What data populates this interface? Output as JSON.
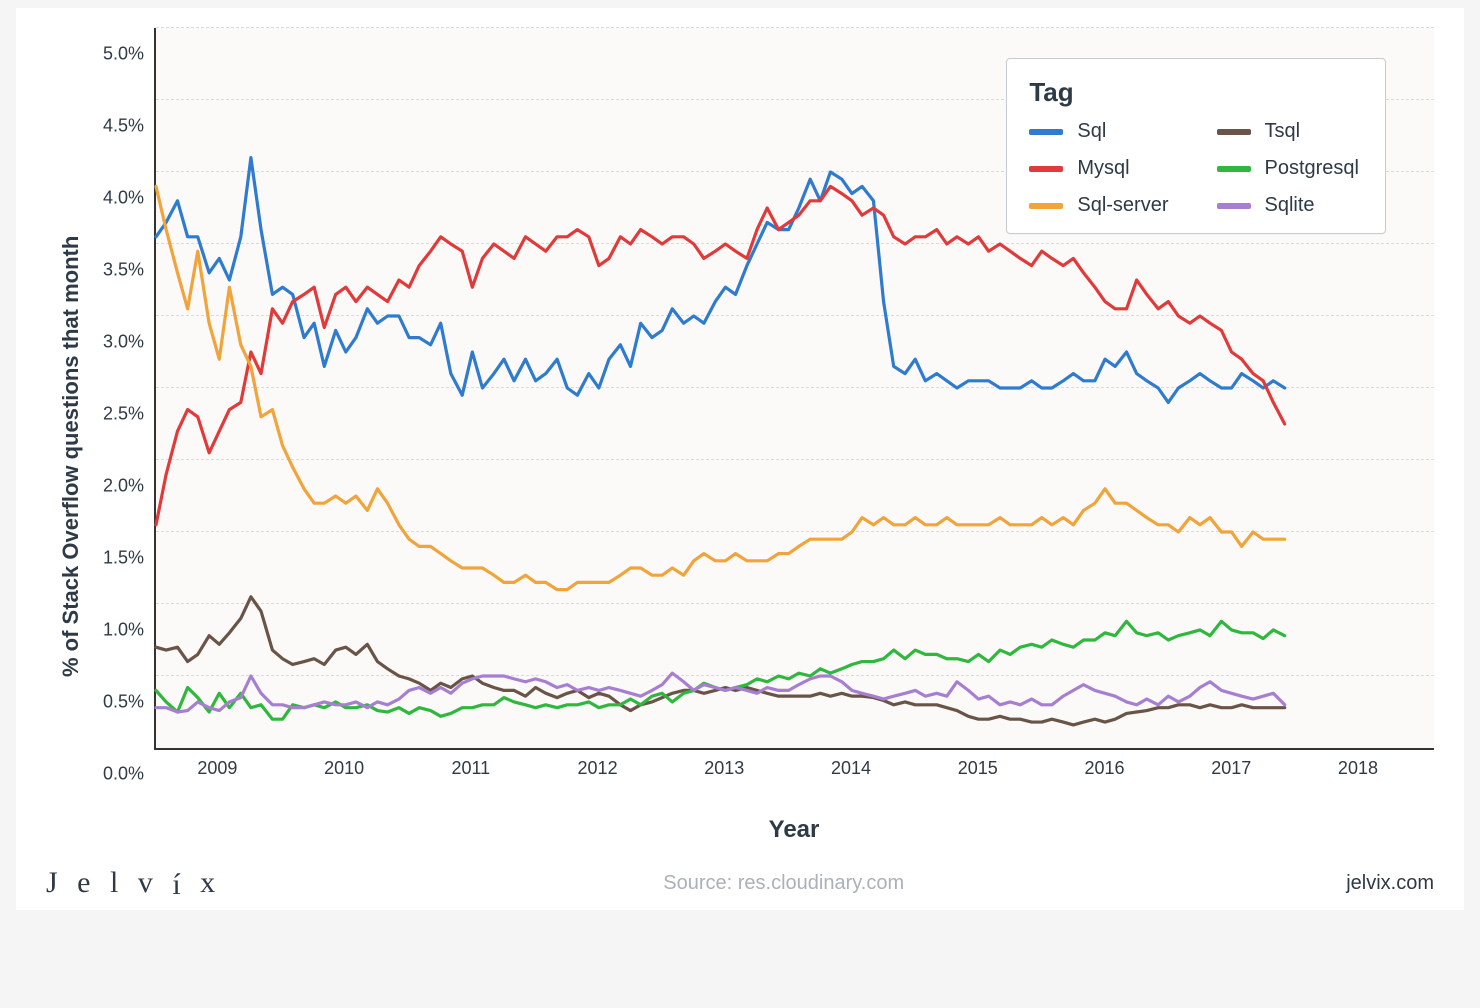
{
  "chart_data": {
    "type": "line",
    "title": null,
    "xlabel": "Year",
    "ylabel": "% of Stack Overflow questions that month",
    "x_numeric_range": [
      2008.5,
      2018.6
    ],
    "x_ticks": [
      2009,
      2010,
      2011,
      2012,
      2013,
      2014,
      2015,
      2016,
      2017,
      2018
    ],
    "y_ticks": [
      0.0,
      0.5,
      1.0,
      1.5,
      2.0,
      2.5,
      3.0,
      3.5,
      4.0,
      4.5,
      5.0
    ],
    "y_tick_labels": [
      "0.0%",
      "0.5%",
      "1.0%",
      "1.5%",
      "2.0%",
      "2.5%",
      "3.0%",
      "3.5%",
      "4.0%",
      "4.5%",
      "5.0%"
    ],
    "ylim": [
      0.0,
      5.0
    ],
    "legend": {
      "title": "Tag",
      "position": "top-right"
    },
    "grid": {
      "x": false,
      "y": true,
      "style": "dashed"
    },
    "x": [
      2008.5,
      2008.58,
      2008.67,
      2008.75,
      2008.83,
      2008.92,
      2009.0,
      2009.08,
      2009.17,
      2009.25,
      2009.33,
      2009.42,
      2009.5,
      2009.58,
      2009.67,
      2009.75,
      2009.83,
      2009.92,
      2010.0,
      2010.08,
      2010.17,
      2010.25,
      2010.33,
      2010.42,
      2010.5,
      2010.58,
      2010.67,
      2010.75,
      2010.83,
      2010.92,
      2011.0,
      2011.08,
      2011.17,
      2011.25,
      2011.33,
      2011.42,
      2011.5,
      2011.58,
      2011.67,
      2011.75,
      2011.83,
      2011.92,
      2012.0,
      2012.08,
      2012.17,
      2012.25,
      2012.33,
      2012.42,
      2012.5,
      2012.58,
      2012.67,
      2012.75,
      2012.83,
      2012.92,
      2013.0,
      2013.08,
      2013.17,
      2013.25,
      2013.33,
      2013.42,
      2013.5,
      2013.58,
      2013.67,
      2013.75,
      2013.83,
      2013.92,
      2014.0,
      2014.08,
      2014.17,
      2014.25,
      2014.33,
      2014.42,
      2014.5,
      2014.58,
      2014.67,
      2014.75,
      2014.83,
      2014.92,
      2015.0,
      2015.08,
      2015.17,
      2015.25,
      2015.33,
      2015.42,
      2015.5,
      2015.58,
      2015.67,
      2015.75,
      2015.83,
      2015.92,
      2016.0,
      2016.08,
      2016.17,
      2016.25,
      2016.33,
      2016.42,
      2016.5,
      2016.58,
      2016.67,
      2016.75,
      2016.83,
      2016.92,
      2017.0,
      2017.08,
      2017.17,
      2017.25,
      2017.33,
      2017.42,
      2017.5,
      2017.58,
      2017.67,
      2017.75,
      2017.83,
      2017.92,
      2018.0,
      2018.08,
      2018.17,
      2018.25,
      2018.33,
      2018.42,
      2018.5,
      2018.58
    ],
    "series": [
      {
        "name": "Sql",
        "color": "#2e7bcf",
        "values": [
          3.55,
          3.65,
          3.8,
          3.55,
          3.55,
          3.3,
          3.4,
          3.25,
          3.55,
          4.1,
          3.6,
          3.15,
          3.2,
          3.15,
          2.85,
          2.95,
          2.65,
          2.9,
          2.75,
          2.85,
          3.05,
          2.95,
          3.0,
          3.0,
          2.85,
          2.85,
          2.8,
          2.95,
          2.6,
          2.45,
          2.75,
          2.5,
          2.6,
          2.7,
          2.55,
          2.7,
          2.55,
          2.6,
          2.7,
          2.5,
          2.45,
          2.6,
          2.5,
          2.7,
          2.8,
          2.65,
          2.95,
          2.85,
          2.9,
          3.05,
          2.95,
          3.0,
          2.95,
          3.1,
          3.2,
          3.15,
          3.35,
          3.5,
          3.65,
          3.6,
          3.6,
          3.75,
          3.95,
          3.8,
          4.0,
          3.95,
          3.85,
          3.9,
          3.8,
          3.1,
          2.65,
          2.6,
          2.7,
          2.55,
          2.6,
          2.55,
          2.5,
          2.55,
          2.55,
          2.55,
          2.5,
          2.5,
          2.5,
          2.55,
          2.5,
          2.5,
          2.55,
          2.6,
          2.55,
          2.55,
          2.7,
          2.65,
          2.75,
          2.6,
          2.55,
          2.5,
          2.4,
          2.5,
          2.55,
          2.6,
          2.55,
          2.5,
          2.5,
          2.6,
          2.55,
          2.5,
          2.55,
          2.5
        ]
      },
      {
        "name": "Mysql",
        "color": "#e13a3a",
        "values": [
          1.55,
          1.9,
          2.2,
          2.35,
          2.3,
          2.05,
          2.2,
          2.35,
          2.4,
          2.75,
          2.6,
          3.05,
          2.95,
          3.1,
          3.15,
          3.2,
          2.92,
          3.15,
          3.2,
          3.1,
          3.2,
          3.15,
          3.1,
          3.25,
          3.2,
          3.35,
          3.45,
          3.55,
          3.5,
          3.45,
          3.2,
          3.4,
          3.5,
          3.45,
          3.4,
          3.55,
          3.5,
          3.45,
          3.55,
          3.55,
          3.6,
          3.55,
          3.35,
          3.4,
          3.55,
          3.5,
          3.6,
          3.55,
          3.5,
          3.55,
          3.55,
          3.5,
          3.4,
          3.45,
          3.5,
          3.45,
          3.4,
          3.6,
          3.75,
          3.6,
          3.65,
          3.7,
          3.8,
          3.8,
          3.9,
          3.85,
          3.8,
          3.7,
          3.75,
          3.7,
          3.55,
          3.5,
          3.55,
          3.55,
          3.6,
          3.5,
          3.55,
          3.5,
          3.55,
          3.45,
          3.5,
          3.45,
          3.4,
          3.35,
          3.45,
          3.4,
          3.35,
          3.4,
          3.3,
          3.2,
          3.1,
          3.05,
          3.05,
          3.25,
          3.15,
          3.05,
          3.1,
          3.0,
          2.95,
          3.0,
          2.95,
          2.9,
          2.75,
          2.7,
          2.6,
          2.55,
          2.4,
          2.25
        ]
      },
      {
        "name": "Sql-server",
        "color": "#f1a33c",
        "values": [
          3.9,
          3.6,
          3.3,
          3.05,
          3.45,
          2.95,
          2.7,
          3.2,
          2.8,
          2.65,
          2.3,
          2.35,
          2.1,
          1.95,
          1.8,
          1.7,
          1.7,
          1.75,
          1.7,
          1.75,
          1.65,
          1.8,
          1.7,
          1.55,
          1.45,
          1.4,
          1.4,
          1.35,
          1.3,
          1.25,
          1.25,
          1.25,
          1.2,
          1.15,
          1.15,
          1.2,
          1.15,
          1.15,
          1.1,
          1.1,
          1.15,
          1.15,
          1.15,
          1.15,
          1.2,
          1.25,
          1.25,
          1.2,
          1.2,
          1.25,
          1.2,
          1.3,
          1.35,
          1.3,
          1.3,
          1.35,
          1.3,
          1.3,
          1.3,
          1.35,
          1.35,
          1.4,
          1.45,
          1.45,
          1.45,
          1.45,
          1.5,
          1.6,
          1.55,
          1.6,
          1.55,
          1.55,
          1.6,
          1.55,
          1.55,
          1.6,
          1.55,
          1.55,
          1.55,
          1.55,
          1.6,
          1.55,
          1.55,
          1.55,
          1.6,
          1.55,
          1.6,
          1.55,
          1.65,
          1.7,
          1.8,
          1.7,
          1.7,
          1.65,
          1.6,
          1.55,
          1.55,
          1.5,
          1.6,
          1.55,
          1.6,
          1.5,
          1.5,
          1.4,
          1.5,
          1.45,
          1.45,
          1.45
        ]
      },
      {
        "name": "Tsql",
        "color": "#6a5447",
        "values": [
          0.7,
          0.68,
          0.7,
          0.6,
          0.65,
          0.78,
          0.72,
          0.8,
          0.9,
          1.05,
          0.95,
          0.68,
          0.62,
          0.58,
          0.6,
          0.62,
          0.58,
          0.68,
          0.7,
          0.65,
          0.72,
          0.6,
          0.55,
          0.5,
          0.48,
          0.45,
          0.4,
          0.45,
          0.42,
          0.48,
          0.5,
          0.45,
          0.42,
          0.4,
          0.4,
          0.36,
          0.42,
          0.38,
          0.35,
          0.38,
          0.4,
          0.35,
          0.38,
          0.36,
          0.3,
          0.26,
          0.3,
          0.32,
          0.35,
          0.38,
          0.4,
          0.4,
          0.38,
          0.4,
          0.42,
          0.4,
          0.42,
          0.4,
          0.38,
          0.36,
          0.36,
          0.36,
          0.36,
          0.38,
          0.36,
          0.38,
          0.36,
          0.36,
          0.35,
          0.33,
          0.3,
          0.32,
          0.3,
          0.3,
          0.3,
          0.28,
          0.26,
          0.22,
          0.2,
          0.2,
          0.22,
          0.2,
          0.2,
          0.18,
          0.18,
          0.2,
          0.18,
          0.16,
          0.18,
          0.2,
          0.18,
          0.2,
          0.24,
          0.25,
          0.26,
          0.28,
          0.28,
          0.3,
          0.3,
          0.28,
          0.3,
          0.28,
          0.28,
          0.3,
          0.28,
          0.28,
          0.28,
          0.28
        ]
      },
      {
        "name": "Postgresql",
        "color": "#2fb83d",
        "values": [
          0.4,
          0.32,
          0.25,
          0.42,
          0.35,
          0.25,
          0.38,
          0.28,
          0.38,
          0.28,
          0.3,
          0.2,
          0.2,
          0.3,
          0.28,
          0.3,
          0.28,
          0.32,
          0.28,
          0.28,
          0.3,
          0.26,
          0.25,
          0.28,
          0.24,
          0.28,
          0.26,
          0.22,
          0.24,
          0.28,
          0.28,
          0.3,
          0.3,
          0.35,
          0.32,
          0.3,
          0.28,
          0.3,
          0.28,
          0.3,
          0.3,
          0.32,
          0.28,
          0.3,
          0.3,
          0.34,
          0.3,
          0.36,
          0.38,
          0.32,
          0.38,
          0.4,
          0.45,
          0.42,
          0.4,
          0.42,
          0.44,
          0.48,
          0.46,
          0.5,
          0.48,
          0.52,
          0.5,
          0.55,
          0.52,
          0.55,
          0.58,
          0.6,
          0.6,
          0.62,
          0.68,
          0.62,
          0.68,
          0.65,
          0.65,
          0.62,
          0.62,
          0.6,
          0.65,
          0.6,
          0.68,
          0.65,
          0.7,
          0.72,
          0.7,
          0.75,
          0.72,
          0.7,
          0.75,
          0.75,
          0.8,
          0.78,
          0.88,
          0.8,
          0.78,
          0.8,
          0.75,
          0.78,
          0.8,
          0.82,
          0.78,
          0.88,
          0.82,
          0.8,
          0.8,
          0.76,
          0.82,
          0.78
        ]
      },
      {
        "name": "Sqlite",
        "color": "#a77fd1",
        "values": [
          0.28,
          0.28,
          0.25,
          0.26,
          0.32,
          0.28,
          0.26,
          0.32,
          0.35,
          0.5,
          0.38,
          0.3,
          0.3,
          0.28,
          0.28,
          0.3,
          0.32,
          0.3,
          0.3,
          0.32,
          0.28,
          0.32,
          0.3,
          0.34,
          0.4,
          0.42,
          0.38,
          0.42,
          0.38,
          0.45,
          0.48,
          0.5,
          0.5,
          0.5,
          0.48,
          0.46,
          0.48,
          0.46,
          0.42,
          0.44,
          0.4,
          0.42,
          0.4,
          0.42,
          0.4,
          0.38,
          0.36,
          0.4,
          0.44,
          0.52,
          0.46,
          0.4,
          0.44,
          0.42,
          0.4,
          0.42,
          0.4,
          0.38,
          0.42,
          0.4,
          0.4,
          0.44,
          0.48,
          0.5,
          0.5,
          0.46,
          0.4,
          0.38,
          0.36,
          0.34,
          0.36,
          0.38,
          0.4,
          0.36,
          0.38,
          0.36,
          0.46,
          0.4,
          0.34,
          0.36,
          0.3,
          0.32,
          0.3,
          0.34,
          0.3,
          0.3,
          0.36,
          0.4,
          0.44,
          0.4,
          0.38,
          0.36,
          0.32,
          0.3,
          0.34,
          0.3,
          0.36,
          0.32,
          0.36,
          0.42,
          0.46,
          0.4,
          0.38,
          0.36,
          0.34,
          0.36,
          0.38,
          0.3
        ]
      }
    ]
  },
  "footer": {
    "logo_text": "Jelvix",
    "source_label": "Source:",
    "source_value": "res.cloudinary.com",
    "site": "jelvix.com"
  }
}
